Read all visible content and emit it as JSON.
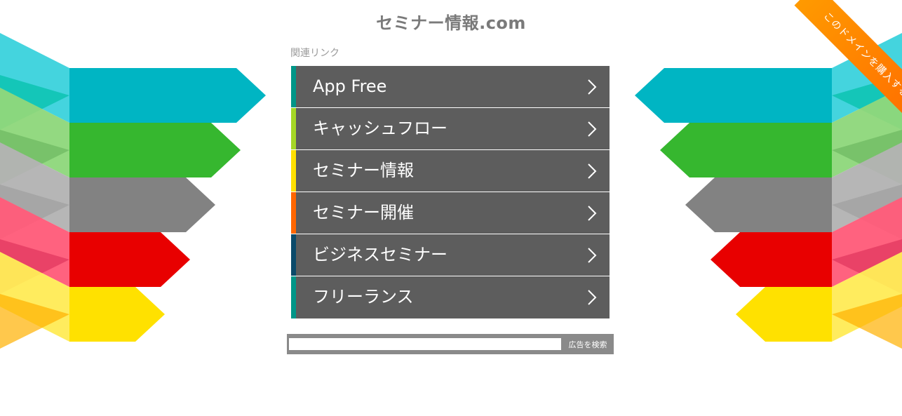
{
  "header": {
    "site_title": "セミナー情報.com"
  },
  "related": {
    "heading": "関連リンク",
    "links": [
      {
        "label": "App Free",
        "accent": "#009688"
      },
      {
        "label": "キャッシュフロー",
        "accent": "#a5d726"
      },
      {
        "label": "セミナー情報",
        "accent": "#ffe000"
      },
      {
        "label": "セミナー開催",
        "accent": "#ff6600"
      },
      {
        "label": "ビジネスセミナー",
        "accent": "#0b4a6a"
      },
      {
        "label": "フリーランス",
        "accent": "#009688"
      }
    ]
  },
  "search": {
    "input_value": "",
    "button_label": "広告を検索"
  },
  "ribbon": {
    "label": "このドメインを購入する。"
  },
  "decor": {
    "colors": [
      "#00b5c3",
      "#36b72f",
      "#828282",
      "#e80000",
      "#ffe100"
    ],
    "light_colors": [
      "#3ad2dc",
      "#8dd77a",
      "#b2b2b2",
      "#ff5a78",
      "#ffeb55"
    ],
    "mid_colors": [
      "#00c0a8",
      "#6cb861",
      "#a0a0a0",
      "#e0345c",
      "#ffb000"
    ]
  }
}
